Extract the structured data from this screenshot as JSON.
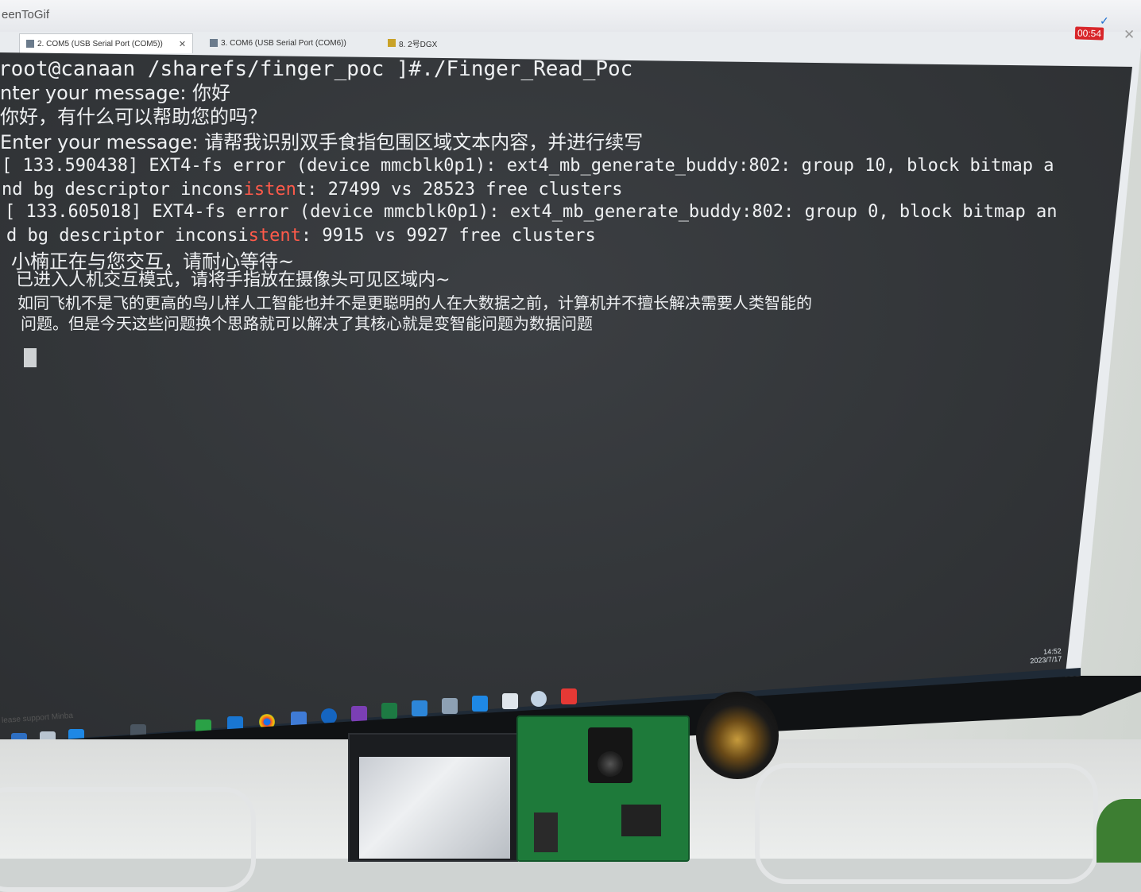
{
  "app": {
    "title": "eenToGif",
    "timer": "00:54"
  },
  "tabs": [
    {
      "label": "2. COM5  (USB Serial Port (COM5))",
      "active": true
    },
    {
      "label": "3. COM6  (USB Serial Port (COM6))",
      "active": false
    },
    {
      "label": "8. 2号DGX",
      "active": false
    }
  ],
  "terminal": {
    "prompt_line": "root@canaan /sharefs/finger_poc ]#./Finger_Read_Poc",
    "line2": "nter your message: 你好",
    "line3": "你好，有什么可以帮助您的吗？",
    "line4": "Enter your message: 请帮我识别双手食指包围区域文本内容，并进行续写",
    "err1_a": "[  133.590438] EXT4-fs error (device mmcblk0p1): ext4_mb_generate_buddy:802: group 10, block bitmap a",
    "err1_b_pre": "nd bg descriptor incons",
    "err1_b_hl": "isten",
    "err1_b_post": "t: 27499 vs 28523 free clusters",
    "err2_a": "[  133.605018] EXT4-fs error (device mmcblk0p1): ext4_mb_generate_buddy:802: group 0, block bitmap an",
    "err2_b_pre": "d bg descriptor inconsi",
    "err2_b_hl": "stent",
    "err2_b_post": ": 9915 vs 9927 free clusters",
    "cn1": "小楠正在与您交互，请耐心等待~",
    "cn2": "已进入人机交互模式，请将手指放在摄像头可见区域内~",
    "cn3": "如同飞机不是飞的更高的鸟儿样人工智能也并不是更聪明的人在大数据之前，计算机并不擅长解决需要人类智能的",
    "cn4": "问题。但是今天这些问题换个思路就可以解决了其核心就是变智能问题为数据问题"
  },
  "taskbar": {
    "support_text": "lease support Minba",
    "clock_time": "14:52",
    "clock_date": "2023/7/17"
  },
  "colors": {
    "terminal_bg": "#333639",
    "terminal_fg": "#eef0f2",
    "highlight": "#ff5a4a"
  }
}
